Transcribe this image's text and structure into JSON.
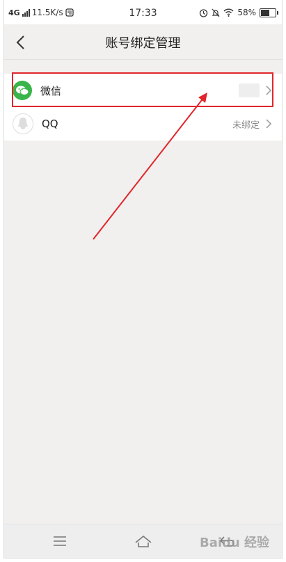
{
  "status_bar": {
    "network": "4G",
    "speed": "11.5K/s",
    "time": "17:33",
    "battery": "58%",
    "battery_level": 0.58
  },
  "header": {
    "title": "账号绑定管理"
  },
  "accounts": [
    {
      "name": "微信",
      "status": "",
      "icon": "wechat-icon"
    },
    {
      "name": "QQ",
      "status": "未绑定",
      "icon": "qq-icon"
    }
  ],
  "watermark": "Baidu 经验",
  "colors": {
    "highlight": "#e0262b",
    "wechat": "#39b54a",
    "background": "#f1f0ef"
  }
}
